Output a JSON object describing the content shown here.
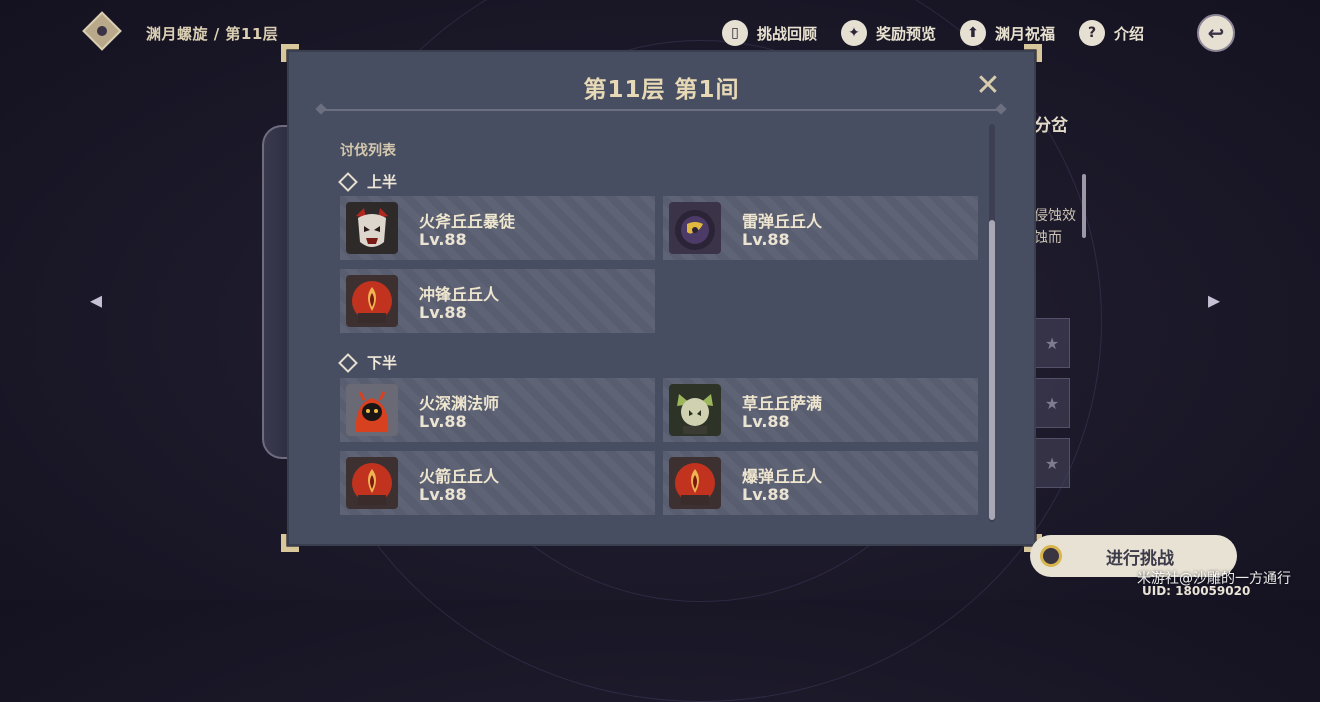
{
  "header": {
    "breadcrumb": "渊月螺旋 / 第11层",
    "actions": [
      {
        "label": "挑战回顾",
        "icon": "book-icon"
      },
      {
        "label": "奖励预览",
        "icon": "star-icon"
      },
      {
        "label": "渊月祝福",
        "icon": "upload-arrow-icon"
      },
      {
        "label": "介绍",
        "icon": "question-icon"
      }
    ]
  },
  "background": {
    "side_text": "分岔",
    "side_desc_line1": "侵蚀效",
    "side_desc_line2": "蚀而"
  },
  "modal": {
    "title": "第11层 第1间",
    "section_title": "讨伐列表",
    "first_half": {
      "label": "上半",
      "enemies": [
        {
          "name": "火斧丘丘暴徒",
          "level": "Lv.88",
          "icon": "hilichurl-mitachurl-icon"
        },
        {
          "name": "雷弹丘丘人",
          "level": "Lv.88",
          "icon": "electro-slime-hilichurl-icon"
        },
        {
          "name": "冲锋丘丘人",
          "level": "Lv.88",
          "icon": "hilichurl-mask-icon"
        }
      ]
    },
    "second_half": {
      "label": "下半",
      "enemies": [
        {
          "name": "火深渊法师",
          "level": "Lv.88",
          "icon": "pyro-abyss-mage-icon"
        },
        {
          "name": "草丘丘萨满",
          "level": "Lv.88",
          "icon": "dendro-samachurl-icon"
        },
        {
          "name": "火箭丘丘人",
          "level": "Lv.88",
          "icon": "hilichurl-mask-icon"
        },
        {
          "name": "爆弹丘丘人",
          "level": "Lv.88",
          "icon": "hilichurl-mask-icon"
        }
      ]
    }
  },
  "footer": {
    "start_label": "进行挑战",
    "watermark": "米游社@沙雕的一方通行",
    "uid": "UID: 180059020"
  },
  "colors": {
    "modal_bg": "#484e62",
    "card_bg": "#5a5f72",
    "title_gold": "#e8d9b6",
    "accent_gold": "#d8b44c"
  }
}
